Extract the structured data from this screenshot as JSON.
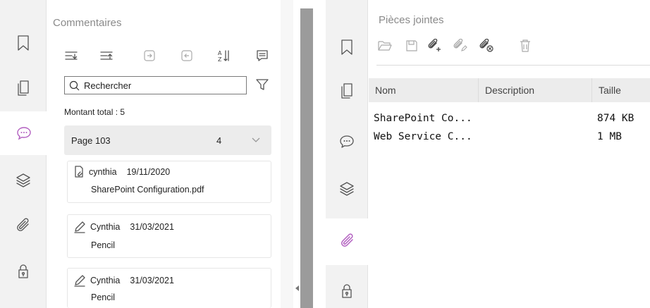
{
  "comments_panel": {
    "title": "Commentaires",
    "search": {
      "value": "Rechercher"
    },
    "total_label": "Montant total : 5",
    "page_group": {
      "label": "Page 103",
      "count": "4"
    },
    "items": [
      {
        "author": "cynthia",
        "date": "19/11/2020",
        "text": "SharePoint Configuration.pdf",
        "icon": "attachment-comment-icon"
      },
      {
        "author": "Cynthia",
        "date": "31/03/2021",
        "text": "Pencil",
        "icon": "pencil-icon"
      },
      {
        "author": "Cynthia",
        "date": "31/03/2021",
        "text": "Pencil",
        "icon": "pencil-icon"
      }
    ],
    "sidebar": [
      "bookmark-icon",
      "pages-icon",
      "comments-icon",
      "layers-icon",
      "attachments-icon",
      "security-icon"
    ],
    "active_sidebar_item": "comments-icon"
  },
  "attachments_panel": {
    "title": "Pièces jointes",
    "columns": [
      "Nom",
      "Description",
      "Taille"
    ],
    "rows": [
      {
        "name": "SharePoint Co...",
        "description": "",
        "size": "874 KB"
      },
      {
        "name": "Web Service C...",
        "description": "",
        "size": "1 MB"
      }
    ],
    "active_sidebar_item": "attachments-icon"
  },
  "colors": {
    "active_icon": "#b25fc0",
    "rail_background": "#f2f2f2",
    "splitter": "#9b9b9b"
  }
}
